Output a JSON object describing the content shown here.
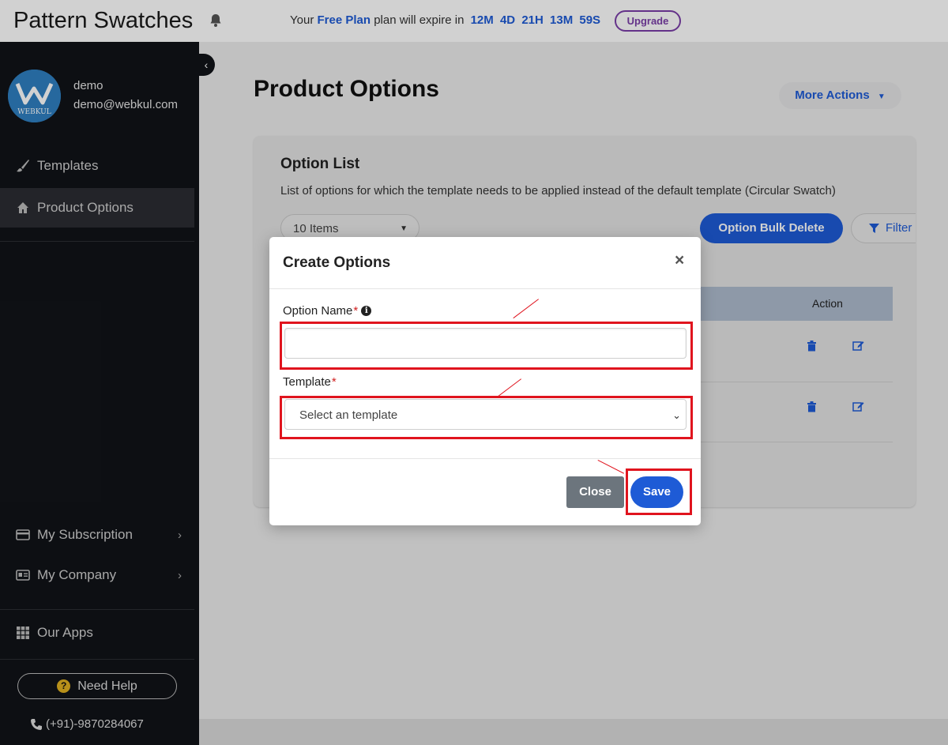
{
  "topbar": {
    "app_title": "Pattern Swatches",
    "plan_prefix": "Your",
    "plan_name": "Free Plan",
    "plan_suffix": "plan will expire in",
    "countdown": [
      "12M",
      "4D",
      "21H",
      "13M",
      "59S"
    ],
    "upgrade_label": "Upgrade"
  },
  "sidebar": {
    "user": {
      "name": "demo",
      "email": "demo@webkul.com",
      "logo_text": "WEBKUL"
    },
    "nav": [
      {
        "label": "Templates",
        "icon": "brush-icon",
        "active": false
      },
      {
        "label": "Product Options",
        "icon": "home-icon",
        "active": true
      }
    ],
    "bottom_nav": [
      {
        "label": "My Subscription",
        "icon": "credit-card-icon"
      },
      {
        "label": "My Company",
        "icon": "id-card-icon"
      },
      {
        "label": "Our Apps",
        "icon": "grid-icon"
      }
    ],
    "help_label": "Need Help",
    "phone": "(+91)-9870284067"
  },
  "main": {
    "page_title": "Product Options",
    "more_actions_label": "More Actions",
    "card": {
      "title": "Option List",
      "description": "List of options for which the template needs to be applied instead of the default template (Circular Swatch)",
      "items_per_page": "10 Items",
      "bulk_delete_label": "Option Bulk Delete",
      "filter_label": "Filter",
      "table": {
        "action_header": "Action"
      }
    }
  },
  "modal": {
    "title": "Create Options",
    "option_name_label": "Option Name",
    "option_name_value": "",
    "template_label": "Template",
    "template_placeholder": "Select an template",
    "close_label": "Close",
    "save_label": "Save"
  },
  "colors": {
    "primary": "#1e5bd6",
    "sidebar_bg": "#111318",
    "upgrade": "#7a3ea8",
    "annotation": "#e0141e",
    "close_button": "#6c757d"
  }
}
